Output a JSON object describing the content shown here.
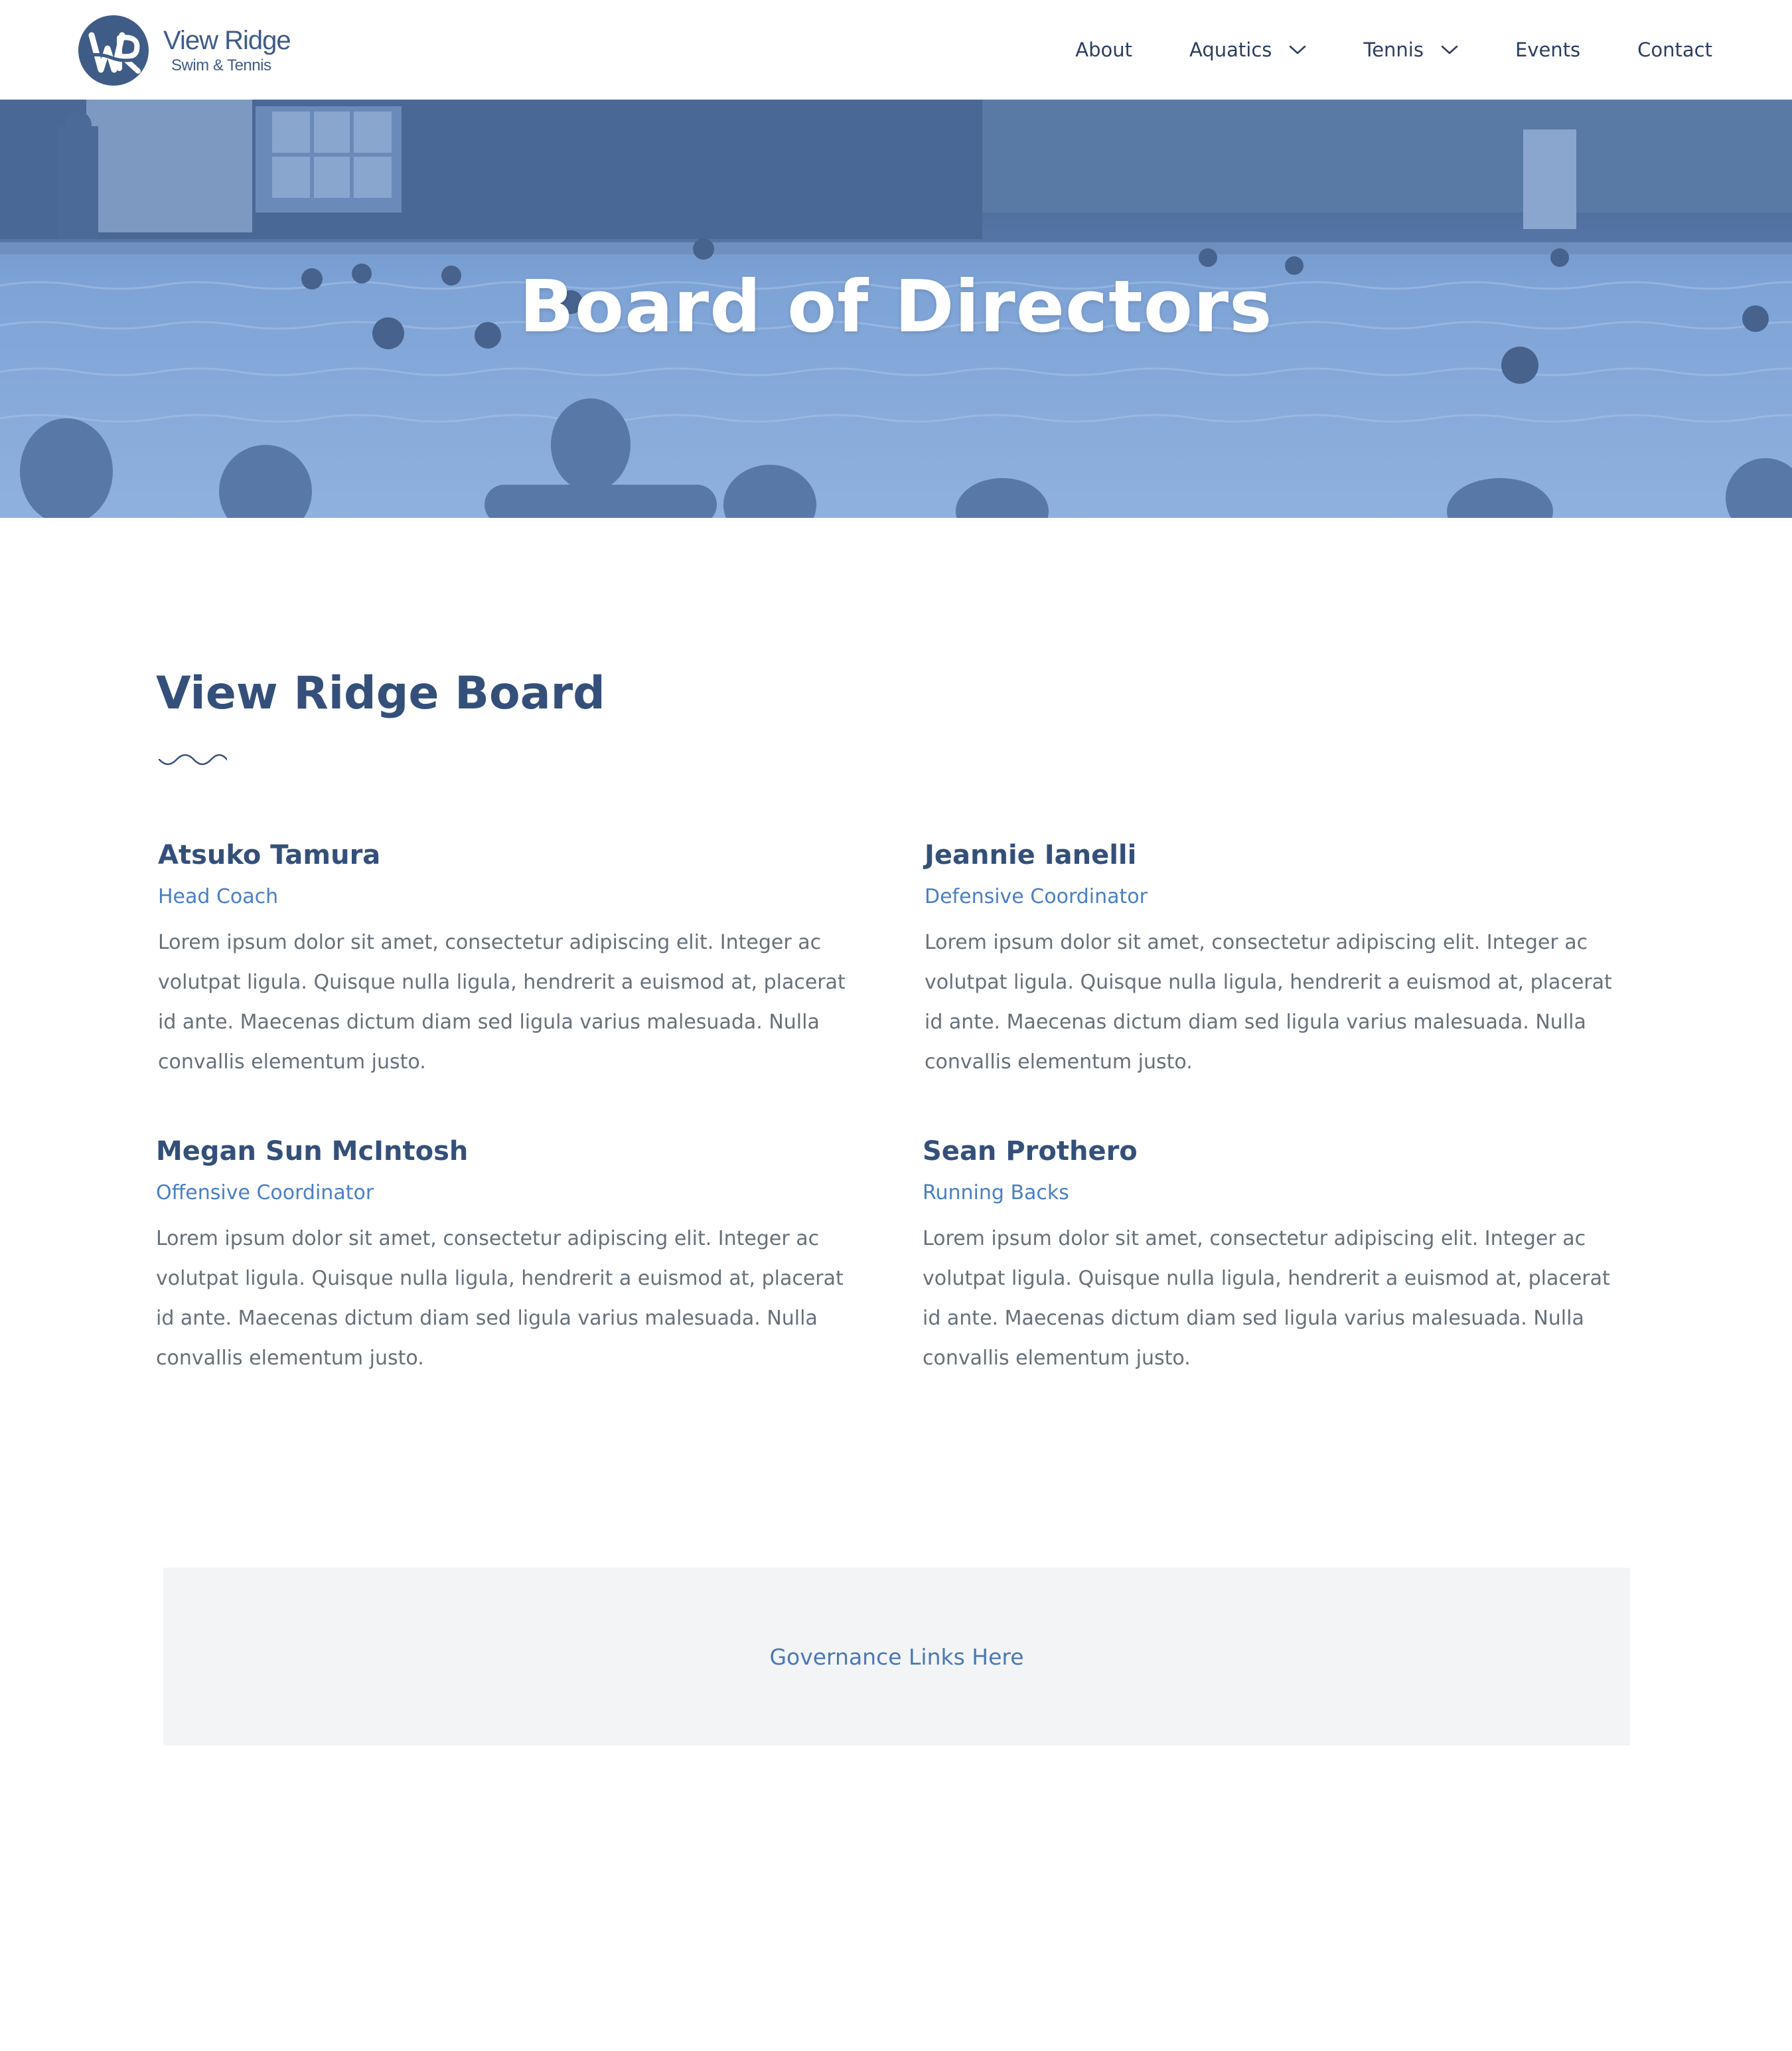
{
  "header": {
    "logo": {
      "name": "View Ridge",
      "subtitle": "Swim & Tennis",
      "mark": "VR"
    },
    "nav": [
      {
        "label": "About",
        "dropdown": false
      },
      {
        "label": "Aquatics",
        "dropdown": true,
        "icon": "chevron-down-icon"
      },
      {
        "label": "Tennis",
        "dropdown": true,
        "icon": "chevron-down-icon"
      },
      {
        "label": "Events",
        "dropdown": false
      },
      {
        "label": "Contact",
        "dropdown": false
      }
    ]
  },
  "hero": {
    "title": "Board of Directors"
  },
  "board": {
    "title": "View Ridge Board",
    "members": [
      {
        "name": "Atsuko Tamura",
        "role": "Head Coach",
        "bio": "Lorem ipsum dolor sit amet, consectetur adipiscing elit. Integer ac volutpat ligula. Quisque nulla ligula, hendrerit a euismod at, placerat id ante. Maecenas dictum diam sed ligula varius malesuada. Nulla convallis elementum justo."
      },
      {
        "name": "Jeannie Ianelli",
        "role": "Defensive Coordinator",
        "bio": "Lorem ipsum dolor sit amet, consectetur adipiscing elit. Integer ac volutpat ligula. Quisque nulla ligula, hendrerit a euismod at, placerat id ante. Maecenas dictum diam sed ligula varius malesuada. Nulla convallis elementum justo."
      },
      {
        "name": "Megan Sun McIntosh",
        "role": "Offensive Coordinator",
        "bio": "Lorem ipsum dolor sit amet, consectetur adipiscing elit. Integer ac volutpat ligula. Quisque nulla ligula, hendrerit a euismod at, placerat id ante. Maecenas dictum diam sed ligula varius malesuada. Nulla convallis elementum justo."
      },
      {
        "name": "Sean Prothero",
        "role": "Running Backs",
        "bio": "Lorem ipsum dolor sit amet, consectetur adipiscing elit. Integer ac volutpat ligula. Quisque nulla ligula, hendrerit a euismod at, placerat id ante. Maecenas dictum diam sed ligula varius malesuada. Nulla convallis elementum justo."
      }
    ]
  },
  "governance": {
    "link_label": "Governance Links Here"
  },
  "colors": {
    "brand": "#3f5c87",
    "heading": "#34507a",
    "accent": "#4a7fc4",
    "body_text": "#66707a",
    "panel": "#f3f4f6"
  }
}
